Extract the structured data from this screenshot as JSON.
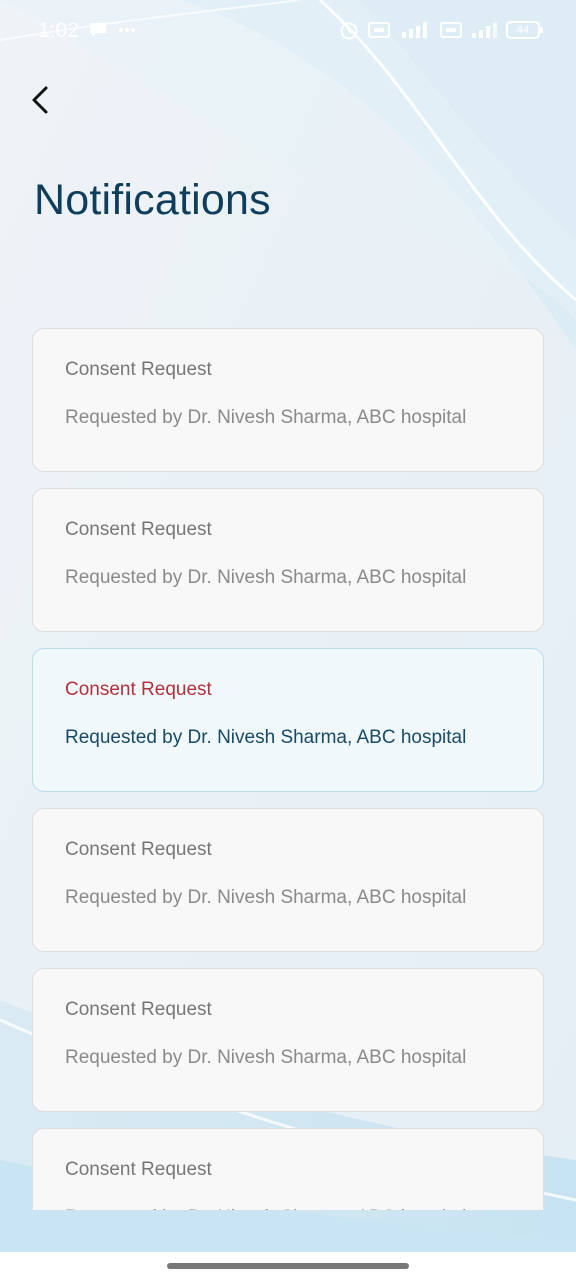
{
  "status_bar": {
    "time": "1:02",
    "left_icons": [
      "chat-bubble-icon",
      "more-dots-icon"
    ],
    "right_icons": [
      "alarm-icon",
      "network-volte-icon",
      "signal-4g-icon",
      "network-volte-icon",
      "signal-icon"
    ],
    "battery": "44"
  },
  "header": {
    "back_icon": "chevron-left-icon",
    "title": "Notifications"
  },
  "notifications": [
    {
      "title": "Consent Request",
      "subtitle": "Requested by Dr. Nivesh Sharma, ABC hospital",
      "highlighted": false
    },
    {
      "title": "Consent Request",
      "subtitle": "Requested by Dr. Nivesh Sharma, ABC hospital",
      "highlighted": false
    },
    {
      "title": "Consent Request",
      "subtitle": "Requested by Dr. Nivesh Sharma, ABC hospital",
      "highlighted": true
    },
    {
      "title": "Consent Request",
      "subtitle": "Requested by Dr. Nivesh Sharma, ABC hospital",
      "highlighted": false
    },
    {
      "title": "Consent Request",
      "subtitle": "Requested by Dr. Nivesh Sharma, ABC hospital",
      "highlighted": false
    },
    {
      "title": "Consent Request",
      "subtitle": "Requested by Dr. Nivesh Sharma, ABC hospital",
      "highlighted": false
    }
  ],
  "colors": {
    "title": "#0f3e5c",
    "highlight_title": "#b0323c",
    "highlight_subtitle": "#184a66",
    "card_bg": "#f8f8f8",
    "highlight_bg": "#f1f8fb"
  }
}
